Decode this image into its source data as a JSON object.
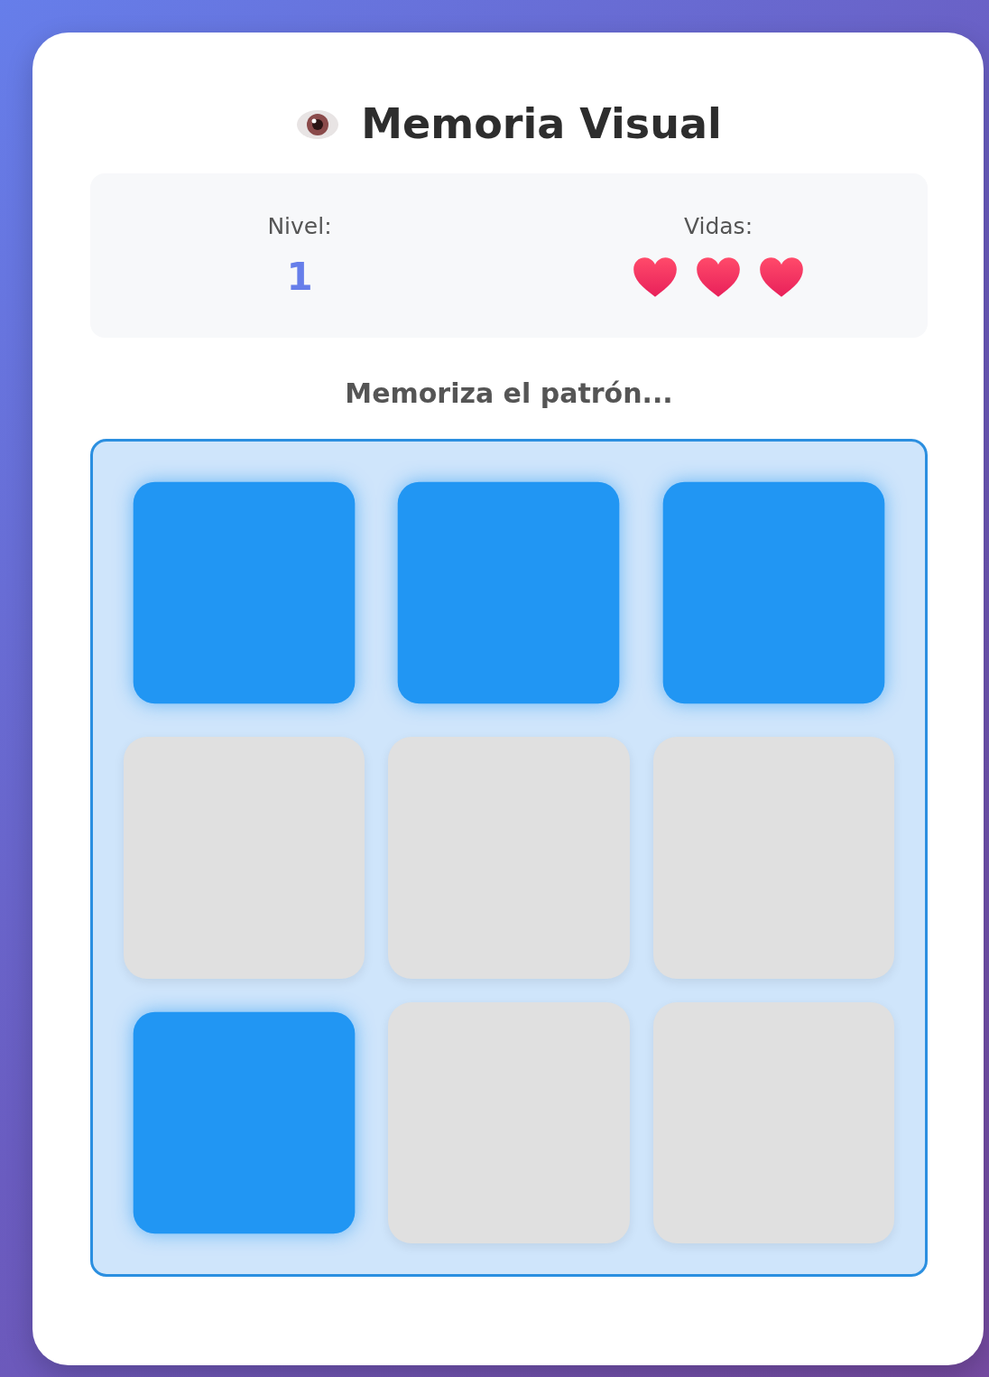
{
  "title": "Memoria Visual",
  "stats": [
    {
      "kind": "number",
      "label": "Nivel:",
      "value": "1"
    },
    {
      "kind": "hearts",
      "label": "Vidas:",
      "hearts": [
        {
          "lost": false
        },
        {
          "lost": false
        },
        {
          "lost": false
        }
      ]
    }
  ],
  "message": "Memoriza el patrón...",
  "grid": {
    "cells": [
      {
        "lit": true
      },
      {
        "lit": true
      },
      {
        "lit": true
      },
      {
        "lit": false
      },
      {
        "lit": false
      },
      {
        "lit": false
      },
      {
        "lit": true
      },
      {
        "lit": false
      },
      {
        "lit": false
      }
    ]
  }
}
